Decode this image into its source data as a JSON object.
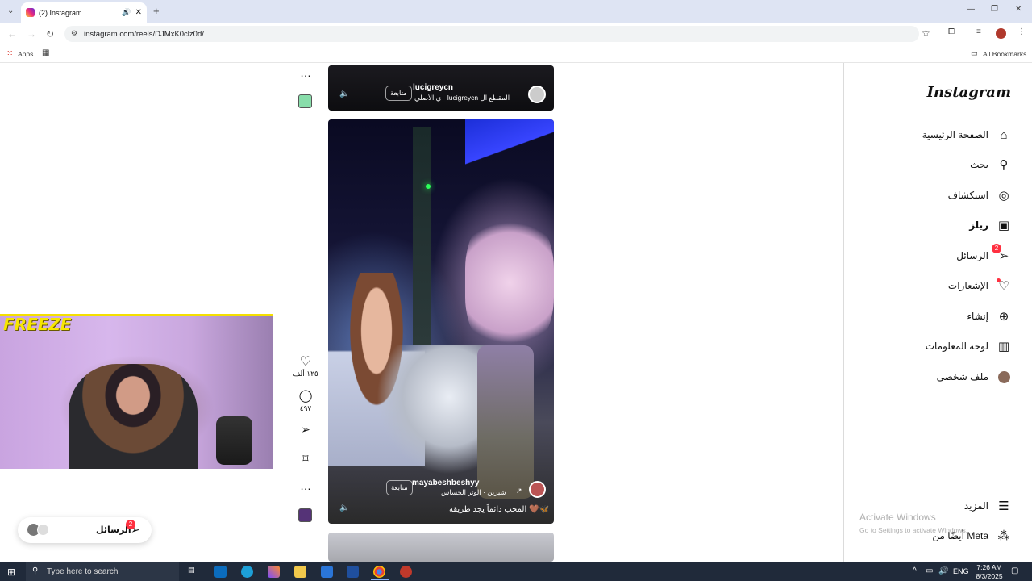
{
  "browser": {
    "tab_title": "(2) Instagram",
    "url": "instagram.com/reels/DJMxK0clz0d/",
    "bookmarks": {
      "apps_label": "Apps",
      "all_bookmarks_label": "All Bookmarks"
    }
  },
  "sidebar": {
    "logo": "Instagram",
    "items": [
      {
        "label": "الصفحة الرئيسية",
        "icon": "home-icon"
      },
      {
        "label": "بحث",
        "icon": "search-icon"
      },
      {
        "label": "استكشاف",
        "icon": "compass-icon"
      },
      {
        "label": "ريلز",
        "icon": "reels-icon",
        "active": true
      },
      {
        "label": "الرسائل",
        "icon": "messages-icon",
        "badge": "2"
      },
      {
        "label": "الإشعارات",
        "icon": "heart-icon"
      },
      {
        "label": "إنشاء",
        "icon": "plus-icon"
      },
      {
        "label": "لوحة المعلومات",
        "icon": "dashboard-icon"
      },
      {
        "label": "ملف شخصي",
        "icon": "avatar-icon"
      }
    ],
    "more_label": "المزيد",
    "meta_label": "أيضًا من Meta"
  },
  "reel_top": {
    "username": "lucigreycn",
    "follow_label": "متابعة",
    "audio_text": "ي الأصلي · lucigreycn المقطع ال"
  },
  "reel_main": {
    "username": "mayabeshbeshyy",
    "follow_label": "متابعة",
    "audio_text": "شيرين · الوتر الحساس",
    "caption": "المحب دائماً يجد طريقه 🤎🦋"
  },
  "actions": {
    "likes": "١٢٥ ألف",
    "comments": "٤٩٧"
  },
  "messages_pill": {
    "label": "الرسائل",
    "badge": "2"
  },
  "webcam_overlay": "FREEZE",
  "watermark": {
    "title": "Activate Windows",
    "subtitle": "Go to Settings to activate Windows."
  },
  "taskbar": {
    "search_placeholder": "Type here to search",
    "lang": "ENG",
    "time": "7:26 AM",
    "date": "8/3/2025"
  }
}
